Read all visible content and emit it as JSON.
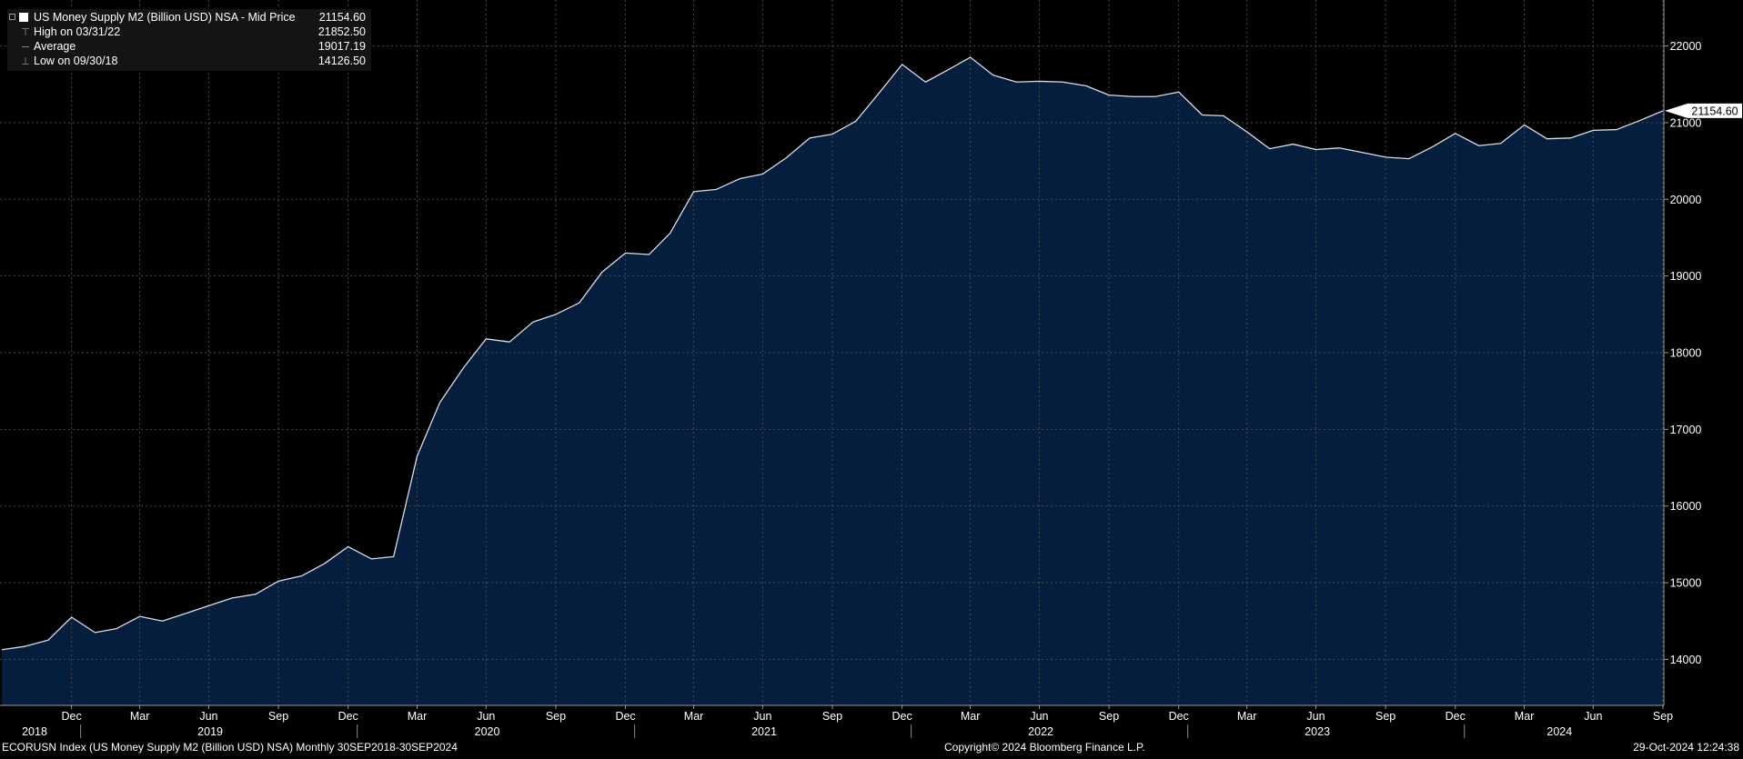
{
  "chart_data": {
    "type": "area",
    "x_type": "date",
    "x": [
      "2018-09-30",
      "2018-10-31",
      "2018-11-30",
      "2018-12-31",
      "2019-01-31",
      "2019-02-28",
      "2019-03-31",
      "2019-04-30",
      "2019-05-31",
      "2019-06-30",
      "2019-07-31",
      "2019-08-31",
      "2019-09-30",
      "2019-10-31",
      "2019-11-30",
      "2019-12-31",
      "2020-01-31",
      "2020-02-29",
      "2020-03-31",
      "2020-04-30",
      "2020-05-31",
      "2020-06-30",
      "2020-07-31",
      "2020-08-31",
      "2020-09-30",
      "2020-10-31",
      "2020-11-30",
      "2020-12-31",
      "2021-01-31",
      "2021-02-28",
      "2021-03-31",
      "2021-04-30",
      "2021-05-31",
      "2021-06-30",
      "2021-07-31",
      "2021-08-31",
      "2021-09-30",
      "2021-10-31",
      "2021-11-30",
      "2021-12-31",
      "2022-01-31",
      "2022-02-28",
      "2022-03-31",
      "2022-04-30",
      "2022-05-31",
      "2022-06-30",
      "2022-07-31",
      "2022-08-31",
      "2022-09-30",
      "2022-10-31",
      "2022-11-30",
      "2022-12-31",
      "2023-01-31",
      "2023-02-28",
      "2023-03-31",
      "2023-04-30",
      "2023-05-31",
      "2023-06-30",
      "2023-07-31",
      "2023-08-31",
      "2023-09-30",
      "2023-10-31",
      "2023-11-30",
      "2023-12-31",
      "2024-01-31",
      "2024-02-29",
      "2024-03-31",
      "2024-04-30",
      "2024-05-31",
      "2024-06-30",
      "2024-07-31",
      "2024-08-31",
      "2024-09-30"
    ],
    "series": [
      {
        "name": "US Money Supply M2 (Billion USD) NSA - Mid Price",
        "values": [
          14126.5,
          14170,
          14250,
          14550,
          14350,
          14400,
          14560,
          14500,
          14600,
          14700,
          14800,
          14850,
          15020,
          15090,
          15250,
          15470,
          15310,
          15340,
          16650,
          17350,
          17800,
          18180,
          18140,
          18400,
          18500,
          18650,
          19050,
          19300,
          19280,
          19560,
          20100,
          20130,
          20270,
          20330,
          20540,
          20800,
          20850,
          21020,
          21380,
          21760,
          21530,
          21680,
          21852.5,
          21620,
          21530,
          21540,
          21530,
          21480,
          21360,
          21340,
          21340,
          21400,
          21100,
          21090,
          20880,
          20660,
          20720,
          20650,
          20670,
          20610,
          20550,
          20530,
          20680,
          20860,
          20700,
          20730,
          20970,
          20790,
          20800,
          20900,
          20910,
          21030,
          21154.6
        ]
      }
    ],
    "title": "",
    "xlabel": "",
    "ylabel": "",
    "ylim": [
      13400,
      22600
    ],
    "y_ticks": [
      14000,
      15000,
      16000,
      17000,
      18000,
      19000,
      20000,
      21000,
      22000
    ],
    "last_value_label": "21154.60",
    "grid": true,
    "legend_position": "top-left",
    "x_month_ticks": [
      {
        "date": "2018-12-31",
        "label": "Dec"
      },
      {
        "date": "2019-03-31",
        "label": "Mar"
      },
      {
        "date": "2019-06-30",
        "label": "Jun"
      },
      {
        "date": "2019-09-30",
        "label": "Sep"
      },
      {
        "date": "2019-12-31",
        "label": "Dec"
      },
      {
        "date": "2020-03-31",
        "label": "Mar"
      },
      {
        "date": "2020-06-30",
        "label": "Jun"
      },
      {
        "date": "2020-09-30",
        "label": "Sep"
      },
      {
        "date": "2020-12-31",
        "label": "Dec"
      },
      {
        "date": "2021-03-31",
        "label": "Mar"
      },
      {
        "date": "2021-06-30",
        "label": "Jun"
      },
      {
        "date": "2021-09-30",
        "label": "Sep"
      },
      {
        "date": "2021-12-31",
        "label": "Dec"
      },
      {
        "date": "2022-03-31",
        "label": "Mar"
      },
      {
        "date": "2022-06-30",
        "label": "Jun"
      },
      {
        "date": "2022-09-30",
        "label": "Sep"
      },
      {
        "date": "2022-12-31",
        "label": "Dec"
      },
      {
        "date": "2023-03-31",
        "label": "Mar"
      },
      {
        "date": "2023-06-30",
        "label": "Jun"
      },
      {
        "date": "2023-09-30",
        "label": "Sep"
      },
      {
        "date": "2023-12-31",
        "label": "Dec"
      },
      {
        "date": "2024-03-31",
        "label": "Mar"
      },
      {
        "date": "2024-06-30",
        "label": "Jun"
      },
      {
        "date": "2024-09-30",
        "label": "Sep"
      }
    ],
    "x_year_labels": [
      {
        "label": "2018",
        "from": "2018-09-30",
        "to": "2018-12-31"
      },
      {
        "label": "2019",
        "from": "2019-01-01",
        "to": "2019-12-31"
      },
      {
        "label": "2020",
        "from": "2020-01-01",
        "to": "2020-12-31"
      },
      {
        "label": "2021",
        "from": "2021-01-01",
        "to": "2021-12-31"
      },
      {
        "label": "2022",
        "from": "2022-01-01",
        "to": "2022-12-31"
      },
      {
        "label": "2023",
        "from": "2023-01-01",
        "to": "2023-12-31"
      },
      {
        "label": "2024",
        "from": "2024-01-01",
        "to": "2024-09-30"
      }
    ],
    "x_year_separators": [
      "2018-12-31",
      "2019-12-31",
      "2020-12-31",
      "2021-12-31",
      "2022-12-31",
      "2023-12-31"
    ],
    "colors": {
      "background": "#000000",
      "area_fill": "#061e3d",
      "line": "#d8dde6",
      "grid": "#4a4a4a",
      "text": "#ffffff"
    }
  },
  "legend": {
    "title": "US Money Supply M2 (Billion USD) NSA - Mid Price",
    "title_value": "21154.60",
    "rows": [
      {
        "label": "High on 03/31/22",
        "value": "21852.50"
      },
      {
        "label": "Average",
        "value": "19017.19"
      },
      {
        "label": "Low on 09/30/18",
        "value": "14126.50"
      }
    ]
  },
  "footer": {
    "left": "ECORUSN Index (US Money Supply M2 (Billion USD) NSA)  Monthly 30SEP2018-30SEP2024",
    "center": "Copyright© 2024 Bloomberg Finance L.P.",
    "right": "29-Oct-2024 12:24:38"
  }
}
